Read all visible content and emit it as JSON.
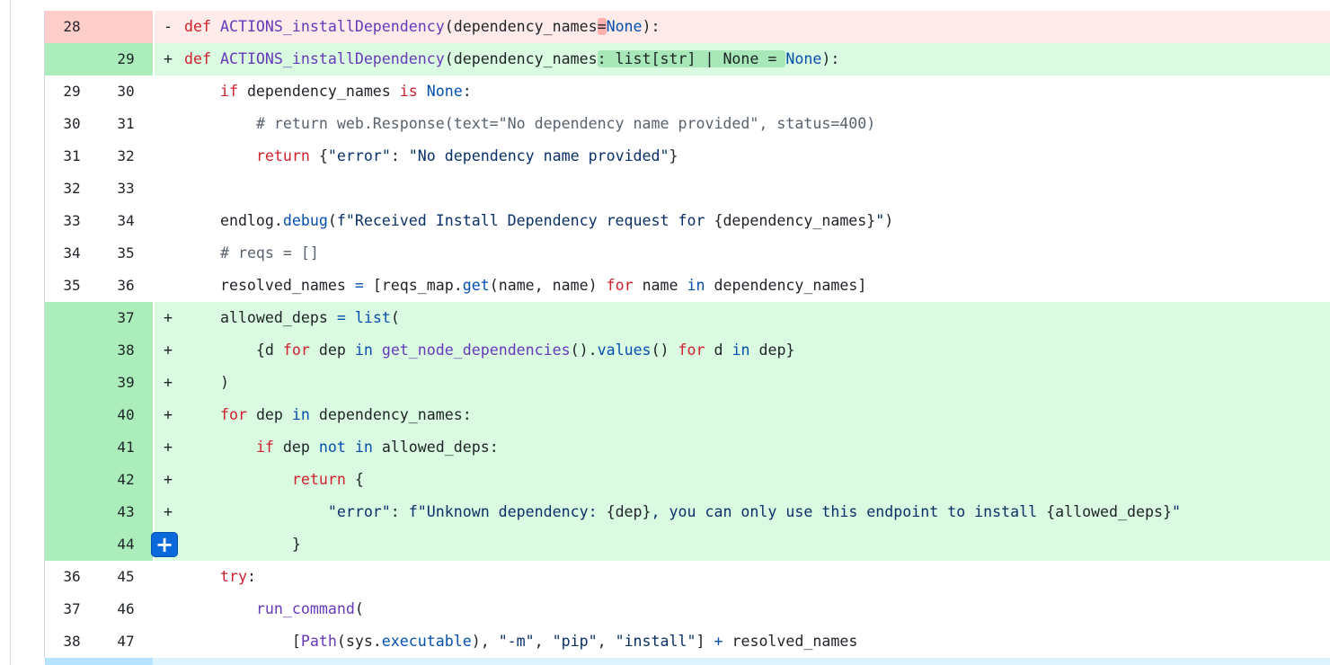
{
  "diff": {
    "rows": [
      {
        "type": "del",
        "old": "28",
        "new": "",
        "marker": "-",
        "segments": [
          {
            "t": "def ",
            "c": "kw"
          },
          {
            "t": "ACTIONS_installDependency",
            "c": "fn"
          },
          {
            "t": "(dependency_names",
            "c": ""
          },
          {
            "t": "=",
            "c": "hl-del"
          },
          {
            "t": "None",
            "c": "bi"
          },
          {
            "t": "):",
            "c": ""
          }
        ]
      },
      {
        "type": "add",
        "old": "",
        "new": "29",
        "marker": "+",
        "segments": [
          {
            "t": "def ",
            "c": "kw"
          },
          {
            "t": "ACTIONS_installDependency",
            "c": "fn"
          },
          {
            "t": "(dependency_names",
            "c": ""
          },
          {
            "t": ": list[str] | None = ",
            "c": "hl-add"
          },
          {
            "t": "None",
            "c": "bi"
          },
          {
            "t": "):",
            "c": ""
          }
        ]
      },
      {
        "type": "ctx",
        "old": "29",
        "new": "30",
        "marker": "",
        "segments": [
          {
            "t": "    ",
            "c": ""
          },
          {
            "t": "if",
            "c": "kw"
          },
          {
            "t": " dependency_names ",
            "c": ""
          },
          {
            "t": "is",
            "c": "kw"
          },
          {
            "t": " ",
            "c": ""
          },
          {
            "t": "None",
            "c": "bi"
          },
          {
            "t": ":",
            "c": ""
          }
        ]
      },
      {
        "type": "ctx",
        "old": "30",
        "new": "31",
        "marker": "",
        "segments": [
          {
            "t": "        ",
            "c": ""
          },
          {
            "t": "# return web.Response(text=\"No dependency name provided\", status=400)",
            "c": "cm"
          }
        ]
      },
      {
        "type": "ctx",
        "old": "31",
        "new": "32",
        "marker": "",
        "segments": [
          {
            "t": "        ",
            "c": ""
          },
          {
            "t": "return",
            "c": "kw"
          },
          {
            "t": " {",
            "c": ""
          },
          {
            "t": "\"error\"",
            "c": "st"
          },
          {
            "t": ": ",
            "c": ""
          },
          {
            "t": "\"No dependency name provided\"",
            "c": "st"
          },
          {
            "t": "}",
            "c": ""
          }
        ]
      },
      {
        "type": "ctx",
        "old": "32",
        "new": "33",
        "marker": "",
        "segments": []
      },
      {
        "type": "ctx",
        "old": "33",
        "new": "34",
        "marker": "",
        "segments": [
          {
            "t": "    endlog.",
            "c": ""
          },
          {
            "t": "debug",
            "c": "bi"
          },
          {
            "t": "(",
            "c": ""
          },
          {
            "t": "f\"Received Install Dependency request for ",
            "c": "st"
          },
          {
            "t": "{dependency_names}",
            "c": ""
          },
          {
            "t": "\"",
            "c": "st"
          },
          {
            "t": ")",
            "c": ""
          }
        ]
      },
      {
        "type": "ctx",
        "old": "34",
        "new": "35",
        "marker": "",
        "segments": [
          {
            "t": "    ",
            "c": ""
          },
          {
            "t": "# reqs = []",
            "c": "cm"
          }
        ]
      },
      {
        "type": "ctx",
        "old": "35",
        "new": "36",
        "marker": "",
        "segments": [
          {
            "t": "    resolved_names ",
            "c": ""
          },
          {
            "t": "=",
            "c": "op"
          },
          {
            "t": " [reqs_map.",
            "c": ""
          },
          {
            "t": "get",
            "c": "bi"
          },
          {
            "t": "(name, name) ",
            "c": ""
          },
          {
            "t": "for",
            "c": "kw"
          },
          {
            "t": " name ",
            "c": ""
          },
          {
            "t": "in",
            "c": "bi"
          },
          {
            "t": " dependency_names]",
            "c": ""
          }
        ]
      },
      {
        "type": "add",
        "old": "",
        "new": "37",
        "marker": "+",
        "segments": [
          {
            "t": "    allowed_deps ",
            "c": ""
          },
          {
            "t": "=",
            "c": "op"
          },
          {
            "t": " ",
            "c": ""
          },
          {
            "t": "list",
            "c": "bi"
          },
          {
            "t": "(",
            "c": ""
          }
        ]
      },
      {
        "type": "add",
        "old": "",
        "new": "38",
        "marker": "+",
        "segments": [
          {
            "t": "        {d ",
            "c": ""
          },
          {
            "t": "for",
            "c": "kw"
          },
          {
            "t": " dep ",
            "c": ""
          },
          {
            "t": "in",
            "c": "bi"
          },
          {
            "t": " ",
            "c": ""
          },
          {
            "t": "get_node_dependencies",
            "c": "fn"
          },
          {
            "t": "().",
            "c": ""
          },
          {
            "t": "values",
            "c": "bi"
          },
          {
            "t": "() ",
            "c": ""
          },
          {
            "t": "for",
            "c": "kw"
          },
          {
            "t": " d ",
            "c": ""
          },
          {
            "t": "in",
            "c": "bi"
          },
          {
            "t": " dep}",
            "c": ""
          }
        ]
      },
      {
        "type": "add",
        "old": "",
        "new": "39",
        "marker": "+",
        "segments": [
          {
            "t": "    )",
            "c": ""
          }
        ]
      },
      {
        "type": "add",
        "old": "",
        "new": "40",
        "marker": "+",
        "segments": [
          {
            "t": "    ",
            "c": ""
          },
          {
            "t": "for",
            "c": "kw"
          },
          {
            "t": " dep ",
            "c": ""
          },
          {
            "t": "in",
            "c": "bi"
          },
          {
            "t": " dependency_names:",
            "c": ""
          }
        ]
      },
      {
        "type": "add",
        "old": "",
        "new": "41",
        "marker": "+",
        "segments": [
          {
            "t": "        ",
            "c": ""
          },
          {
            "t": "if",
            "c": "kw"
          },
          {
            "t": " dep ",
            "c": ""
          },
          {
            "t": "not",
            "c": "bi"
          },
          {
            "t": " ",
            "c": ""
          },
          {
            "t": "in",
            "c": "bi"
          },
          {
            "t": " allowed_deps:",
            "c": ""
          }
        ]
      },
      {
        "type": "add",
        "old": "",
        "new": "42",
        "marker": "+",
        "segments": [
          {
            "t": "            ",
            "c": ""
          },
          {
            "t": "return",
            "c": "kw"
          },
          {
            "t": " {",
            "c": ""
          }
        ]
      },
      {
        "type": "add",
        "old": "",
        "new": "43",
        "marker": "+",
        "segments": [
          {
            "t": "                ",
            "c": ""
          },
          {
            "t": "\"error\"",
            "c": "st"
          },
          {
            "t": ": ",
            "c": ""
          },
          {
            "t": "f\"Unknown dependency: ",
            "c": "st"
          },
          {
            "t": "{dep}",
            "c": ""
          },
          {
            "t": ", you can only use this endpoint to install ",
            "c": "st"
          },
          {
            "t": "{allowed_deps}",
            "c": ""
          },
          {
            "t": "\"",
            "c": "st"
          }
        ]
      },
      {
        "type": "add",
        "old": "",
        "new": "44",
        "marker": "",
        "add_button": true,
        "segments": [
          {
            "t": "            }",
            "c": ""
          }
        ]
      },
      {
        "type": "ctx",
        "old": "36",
        "new": "45",
        "marker": "",
        "segments": [
          {
            "t": "    ",
            "c": ""
          },
          {
            "t": "try",
            "c": "kw"
          },
          {
            "t": ":",
            "c": ""
          }
        ]
      },
      {
        "type": "ctx",
        "old": "37",
        "new": "46",
        "marker": "",
        "segments": [
          {
            "t": "        ",
            "c": ""
          },
          {
            "t": "run_command",
            "c": "fn"
          },
          {
            "t": "(",
            "c": ""
          }
        ]
      },
      {
        "type": "ctx",
        "old": "38",
        "new": "47",
        "marker": "",
        "segments": [
          {
            "t": "            [",
            "c": ""
          },
          {
            "t": "Path",
            "c": "fn"
          },
          {
            "t": "(sys.",
            "c": ""
          },
          {
            "t": "executable",
            "c": "bi"
          },
          {
            "t": "), ",
            "c": ""
          },
          {
            "t": "\"-m\"",
            "c": "st"
          },
          {
            "t": ", ",
            "c": ""
          },
          {
            "t": "\"pip\"",
            "c": "st"
          },
          {
            "t": ", ",
            "c": ""
          },
          {
            "t": "\"install\"",
            "c": "st"
          },
          {
            "t": "] ",
            "c": ""
          },
          {
            "t": "+",
            "c": "op"
          },
          {
            "t": " resolved_names",
            "c": ""
          }
        ]
      }
    ],
    "add_button_glyph": "+"
  },
  "colors": {
    "deletion_bg": "#ffebe9",
    "deletion_num_bg": "#ffcecb",
    "addition_bg": "#dafbe1",
    "addition_num_bg": "#aceebb",
    "accent": "#0969da"
  }
}
